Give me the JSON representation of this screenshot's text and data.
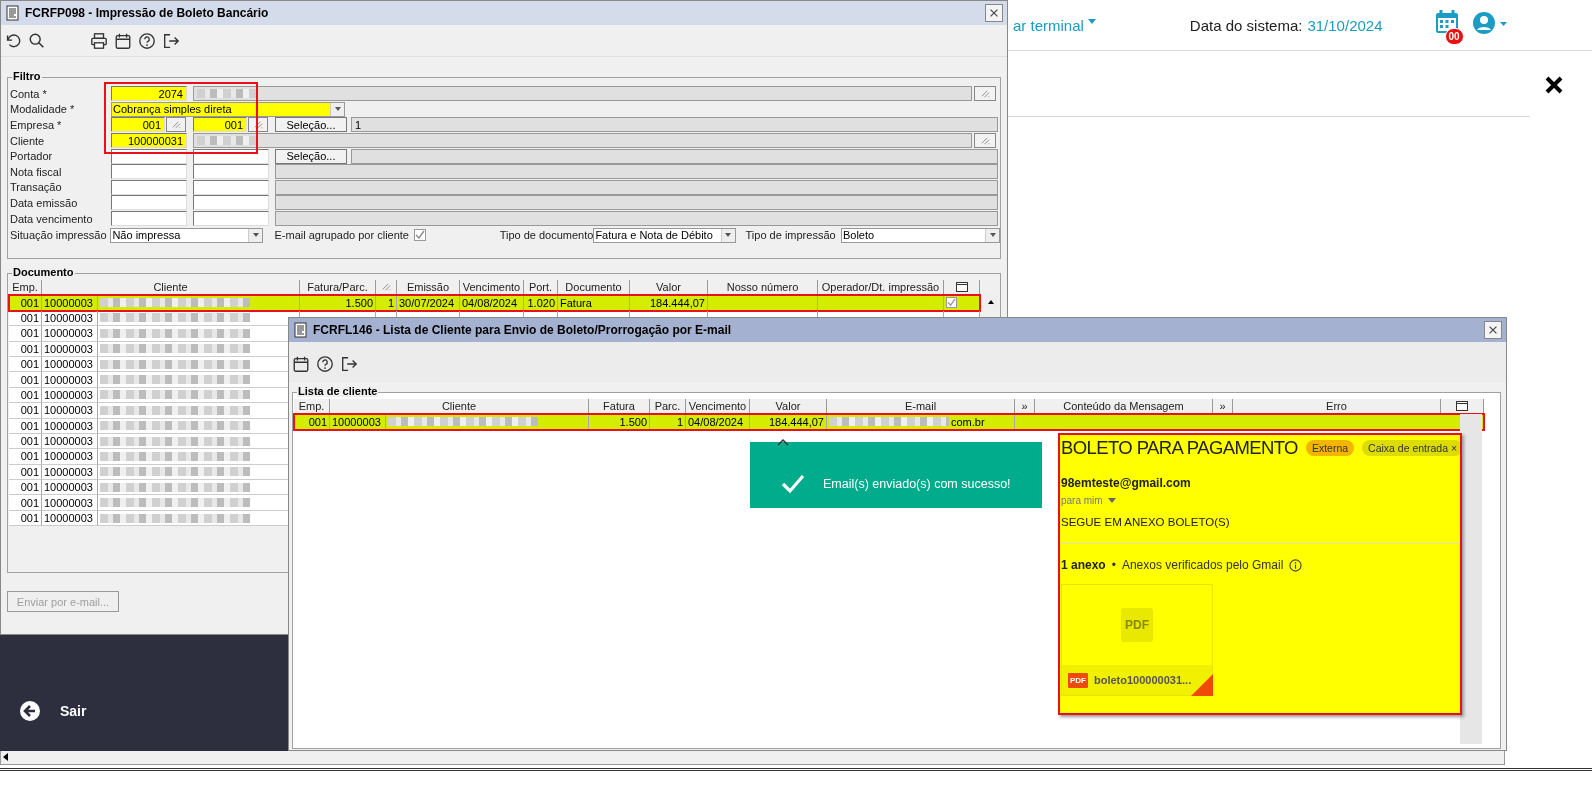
{
  "app_header": {
    "terminal_menu": "ar terminal",
    "system_date_label": "Data do sistema:",
    "system_date": "31/10/2024",
    "calendar_badge": "00"
  },
  "side_menu": {
    "exit_label": "Sair"
  },
  "main_window": {
    "title": "FCRFP098 - Impressão de Boleto Bancário",
    "filter": {
      "title": "Filtro",
      "rows": [
        {
          "kind": "lookup",
          "label": "Conta *",
          "value": "2074",
          "redacted": true,
          "highlighted": true
        },
        {
          "kind": "select",
          "label": "Modalidade *",
          "value": "Cobrança simples direta",
          "highlighted": true
        },
        {
          "kind": "range",
          "label": "Empresa *",
          "from": "001",
          "to": "001",
          "picker": true,
          "button": "Seleção...",
          "selection": "1",
          "highlighted": true
        },
        {
          "kind": "lookup",
          "label": "Cliente",
          "value": "100000031",
          "redacted": true,
          "highlighted": true
        },
        {
          "kind": "range",
          "label": "Portador",
          "picker": false,
          "button": "Seleção...",
          "highlighted": false
        },
        {
          "kind": "range",
          "label": "Nota fiscal",
          "picker": false,
          "highlighted": false
        },
        {
          "kind": "range",
          "label": "Transação",
          "picker": false,
          "highlighted": false
        },
        {
          "kind": "range",
          "label": "Data emissão",
          "picker": false,
          "highlighted": false
        },
        {
          "kind": "range",
          "label": "Data vencimento",
          "picker": false,
          "highlighted": false
        }
      ],
      "options": [
        {
          "kind": "select",
          "label": "Situação impressão",
          "value": "Não impressa"
        },
        {
          "kind": "checkbox",
          "label": "E-mail agrupado por cliente",
          "checked": true
        },
        {
          "kind": "select",
          "label": "Tipo de documento",
          "value": "Fatura e Nota de Débito"
        },
        {
          "kind": "select",
          "label": "Tipo de impressão",
          "value": "Boleto"
        }
      ]
    },
    "documents": {
      "title": "Documento",
      "columns": [
        {
          "kind": "text",
          "label": "Emp."
        },
        {
          "kind": "text",
          "label": "Cliente"
        },
        {
          "kind": "text",
          "label": "Fatura/Parc."
        },
        {
          "kind": "picker"
        },
        {
          "kind": "text",
          "label": "Emissão"
        },
        {
          "kind": "text",
          "label": "Vencimento"
        },
        {
          "kind": "text",
          "label": "Port."
        },
        {
          "kind": "text",
          "label": "Documento"
        },
        {
          "kind": "text",
          "label": "Valor"
        },
        {
          "kind": "text",
          "label": "Nosso número"
        },
        {
          "kind": "text",
          "label": "Operador/Dt. impressão"
        },
        {
          "kind": "checkbox"
        }
      ],
      "rows": [
        {
          "selected": true,
          "emp": "001",
          "client_code": "10000003",
          "client_name_redacted": true,
          "fatura": "1.500",
          "parc": "1",
          "emissao": "30/07/2024",
          "vencimento": "04/08/2024",
          "port": "1.020",
          "documento": "Fatura",
          "valor": "184.444,07",
          "printed": true
        },
        {
          "selected": false,
          "emp": "001",
          "client_code": "10000003",
          "client_name_redacted": true
        },
        {
          "selected": false,
          "emp": "001",
          "client_code": "10000003",
          "client_name_redacted": true
        },
        {
          "selected": false,
          "emp": "001",
          "client_code": "10000003",
          "client_name_redacted": true
        },
        {
          "selected": false,
          "emp": "001",
          "client_code": "10000003",
          "client_name_redacted": true
        },
        {
          "selected": false,
          "emp": "001",
          "client_code": "10000003",
          "client_name_redacted": true
        },
        {
          "selected": false,
          "emp": "001",
          "client_code": "10000003",
          "client_name_redacted": true
        },
        {
          "selected": false,
          "emp": "001",
          "client_code": "10000003",
          "client_name_redacted": true
        },
        {
          "selected": false,
          "emp": "001",
          "client_code": "10000003",
          "client_name_redacted": true
        },
        {
          "selected": false,
          "emp": "001",
          "client_code": "10000003",
          "client_name_redacted": true
        },
        {
          "selected": false,
          "emp": "001",
          "client_code": "10000003",
          "client_name_redacted": true
        },
        {
          "selected": false,
          "emp": "001",
          "client_code": "10000003",
          "client_name_redacted": true
        },
        {
          "selected": false,
          "emp": "001",
          "client_code": "10000003",
          "client_name_redacted": true
        },
        {
          "selected": false,
          "emp": "001",
          "client_code": "10000003",
          "client_name_redacted": true
        },
        {
          "selected": false,
          "emp": "001",
          "client_code": "10000003",
          "client_name_redacted": true
        }
      ]
    },
    "send_button": {
      "label": "Enviar por e-mail...",
      "disabled": true
    }
  },
  "client_window": {
    "title": "FCRFL146 - Lista de Cliente para Envio de Boleto/Prorrogação por E-mail",
    "list": {
      "title": "Lista de cliente",
      "columns": [
        {
          "kind": "text",
          "label": "Emp."
        },
        {
          "kind": "text",
          "label": "Cliente"
        },
        {
          "kind": "text",
          "label": "Fatura"
        },
        {
          "kind": "text",
          "label": "Parc."
        },
        {
          "kind": "text",
          "label": "Vencimento"
        },
        {
          "kind": "text",
          "label": "Valor"
        },
        {
          "kind": "text",
          "label": "E-mail"
        },
        {
          "kind": "text",
          "label": "»"
        },
        {
          "kind": "text",
          "label": "Conteúdo da Mensagem"
        },
        {
          "kind": "text",
          "label": "»"
        },
        {
          "kind": "text",
          "label": "Erro"
        },
        {
          "kind": "checkbox"
        }
      ],
      "rows": [
        {
          "selected": true,
          "emp": "001",
          "client_code": "10000003",
          "client_name_redacted": true,
          "fatura": "1.500",
          "parc": "1",
          "vencimento": "04/08/2024",
          "valor": "184.444,07",
          "email_redacted": true,
          "email": "com.br"
        }
      ]
    }
  },
  "toast": {
    "message": "Email(s) enviado(s) com sucesso!"
  },
  "email_preview": {
    "subject": "BOLETO PARA PAGAMENTO",
    "labels": [
      {
        "text": "Externa",
        "color": "#f5b400",
        "removable": false
      },
      {
        "text": "Caixa de entrada",
        "color": "#dcdc00",
        "removable": true
      }
    ],
    "remove_symbol": "×",
    "sender": "98emteste@gmail.com",
    "recipient": "para mim",
    "body": "SEGUE EM ANEXO BOLETO(S)",
    "attachments_count": "1 anexo",
    "separator": "•",
    "attachments_note": "Anexos verificados pelo Gmail",
    "attachment": {
      "thumb_label": "PDF",
      "type_label": "PDF",
      "file_name": "boleto100000031..."
    }
  }
}
